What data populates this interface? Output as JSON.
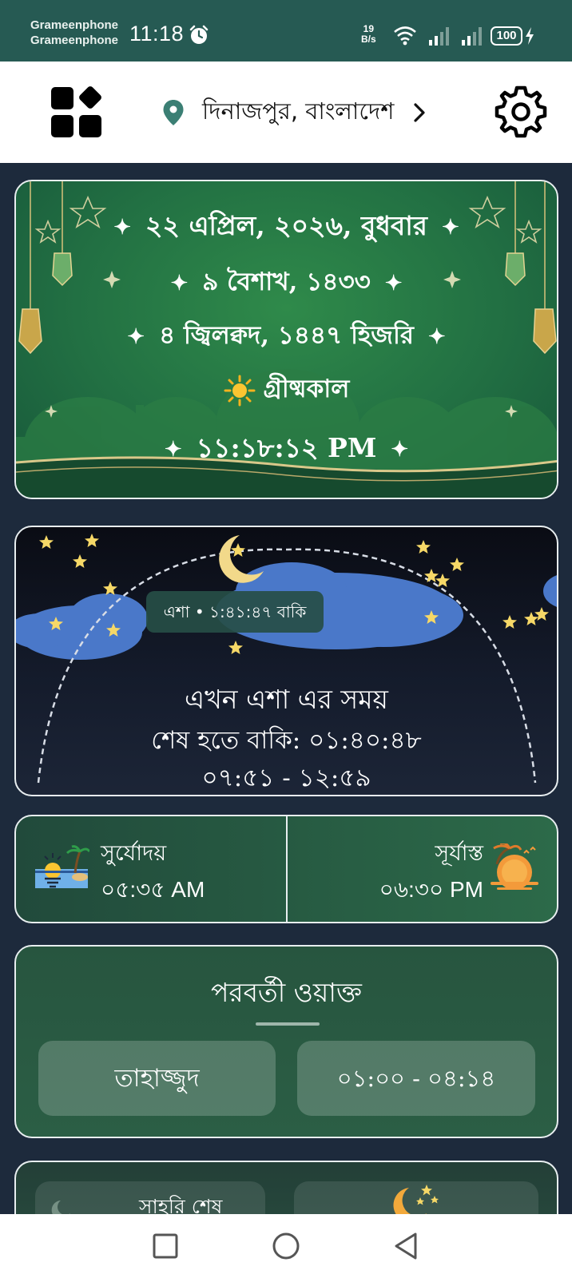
{
  "status_bar": {
    "carrier_1": "Grameenphone",
    "carrier_2": "Grameenphone",
    "time": "11:18",
    "net_speed_value": "19",
    "net_speed_unit": "B/s",
    "battery": "100"
  },
  "header": {
    "location": "দিনাজপুর, বাংলাদেশ",
    "icons": [
      "menu-grid-icon",
      "location-pin-icon",
      "chevron-right-icon",
      "gear-icon"
    ]
  },
  "date_card": {
    "gregorian": "২২ এপ্রিল, ২০২৬, বুধবার",
    "bangla": "৯ বৈশাখ, ১৪৩৩",
    "hijri": "৪ জ্বিলক্বদ, ১৪৪৭ হিজরি",
    "season": "গ্রীষ্মকাল",
    "clock": "১১:১৮:১২ PM",
    "star_glyph": "✦"
  },
  "prayer_arc": {
    "chip": "এশা • ১:৪১:৪৭ বাকি",
    "title": "এখন এশা এর সময়",
    "remaining": "শেষ হতে বাকি: ০১:৪০:৪৮",
    "range": "০৭:৫১ - ১২:৫৯"
  },
  "sun": {
    "sunrise_label": "সুর্যোদয়",
    "sunrise_time": "০৫:৩৫ AM",
    "sunset_label": "সূর্যাস্ত",
    "sunset_time": "০৬:৩০ PM"
  },
  "next_waqt": {
    "title": "পরবর্তী ওয়াক্ত",
    "name": "তাহাজ্জুদ",
    "time_range": "০১:০০ - ০৪:১৪"
  },
  "sehri": {
    "title": "সাহরি শেষ"
  },
  "colors": {
    "status_bar": "#265a53",
    "page_bg": "#1d2a3c",
    "card_green": "#227043",
    "card_border": "#e8eef0"
  }
}
